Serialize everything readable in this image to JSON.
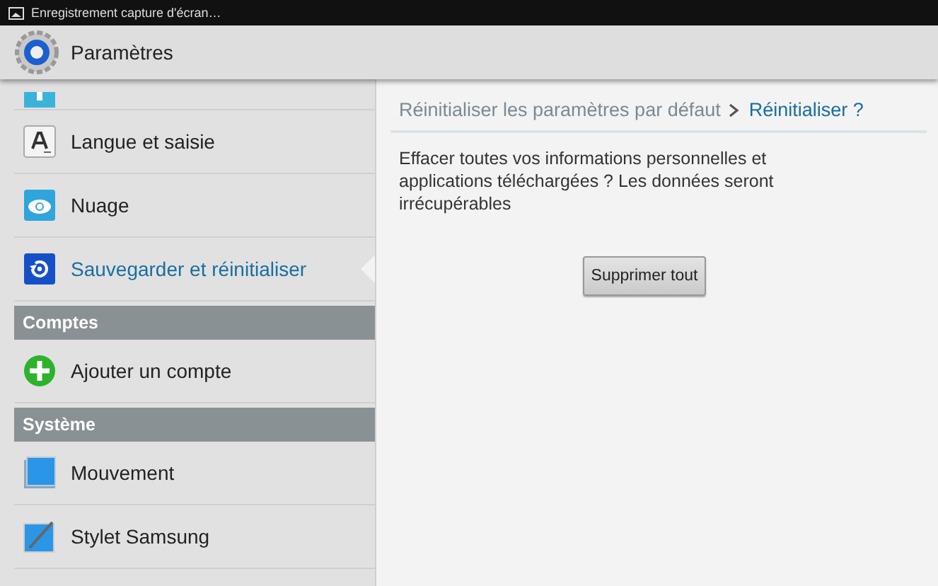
{
  "status_bar": {
    "notification": "Enregistrement capture d'écran…"
  },
  "action_bar": {
    "title": "Paramètres"
  },
  "sidebar": {
    "items": [
      {
        "kind": "item",
        "label": "Langue et saisie",
        "selected": false
      },
      {
        "kind": "item",
        "label": "Nuage",
        "selected": false
      },
      {
        "kind": "item",
        "label": "Sauvegarder et réinitialiser",
        "selected": true
      },
      {
        "kind": "header",
        "label": "Comptes"
      },
      {
        "kind": "item",
        "label": "Ajouter un compte",
        "selected": false
      },
      {
        "kind": "header",
        "label": "Système"
      },
      {
        "kind": "item",
        "label": "Mouvement",
        "selected": false
      },
      {
        "kind": "item",
        "label": "Stylet Samsung",
        "selected": false
      }
    ]
  },
  "detail": {
    "breadcrumb": [
      {
        "label": "Réinitialiser les paramètres par défaut",
        "selected": false
      },
      {
        "label": "Réinitialiser ?",
        "selected": true
      }
    ],
    "message": "Effacer toutes vos informations personnelles et applications téléchargées ? Les données seront irrécupérables",
    "button": "Supprimer tout"
  }
}
